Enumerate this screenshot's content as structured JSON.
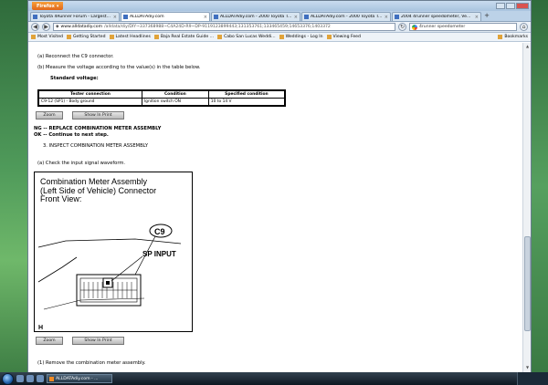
{
  "browser": {
    "menu_label": "Firefox",
    "tabs": [
      {
        "label": "Toyota 4Runner Forum - Largest 4Ru...",
        "active": false
      },
      {
        "label": "ALLDATAdiy.com",
        "active": true
      },
      {
        "label": "ALLDATAdiy.com - 2000 Toyota Truc...",
        "active": false
      },
      {
        "label": "ALLDATAdiy.com - 2000 Toyota Truc...",
        "active": false
      },
      {
        "label": "2004 4runner speedometer, Vehicle (...",
        "active": false
      }
    ],
    "url_domain": "www.alldatadiy.com",
    "url_rest": "/alldata/diy/DIY~337368988~C4A24D-R9~DP-9119123899443;131353761;133465459;14653376;1403372",
    "search_value": "4runner speedometer",
    "bookmarks": [
      "Most Visited",
      "Getting Started",
      "Latest Headlines",
      "Baja Real Estate Guide ...",
      "Cabo San Lucas Weddi...",
      "Weddings - Log In",
      "Viewing Feed"
    ],
    "bookmarks_menu": "Bookmarks"
  },
  "page": {
    "step_a": "(a)   Reconnect the C9 connector.",
    "step_b": "(b)   Measure the voltage according to the value(s) in the table below.",
    "std_voltage": "Standard voltage:",
    "table": {
      "headers": [
        "Tester connection",
        "Condition",
        "Specified condition"
      ],
      "rows": [
        [
          "C9-12 (SP1) - Body ground",
          "Ignition switch ON",
          "10 to 14 V"
        ]
      ]
    },
    "zoom_label": "Zoom",
    "show_label": "Show In Print",
    "ng_line": "NG -- REPLACE COMBINATION METER ASSEMBLY",
    "ok_line": "OK -- Continue to next step.",
    "step3": "3.  INSPECT COMBINATION METER ASSEMBLY",
    "step_a2": "(a)   Check the input signal waveform.",
    "diagram": {
      "caption_line1": "Combination Meter Assembly",
      "caption_line2": "(Left Side of Vehicle) Connector",
      "caption_line3": "Front View:",
      "connector_label": "C9",
      "sp_label": "SP INPUT",
      "corner_label": "H"
    },
    "step_1": "(1)   Remove the combination meter assembly."
  },
  "taskbar": {
    "task_label": "ALLDATAdiy.com - ..."
  }
}
